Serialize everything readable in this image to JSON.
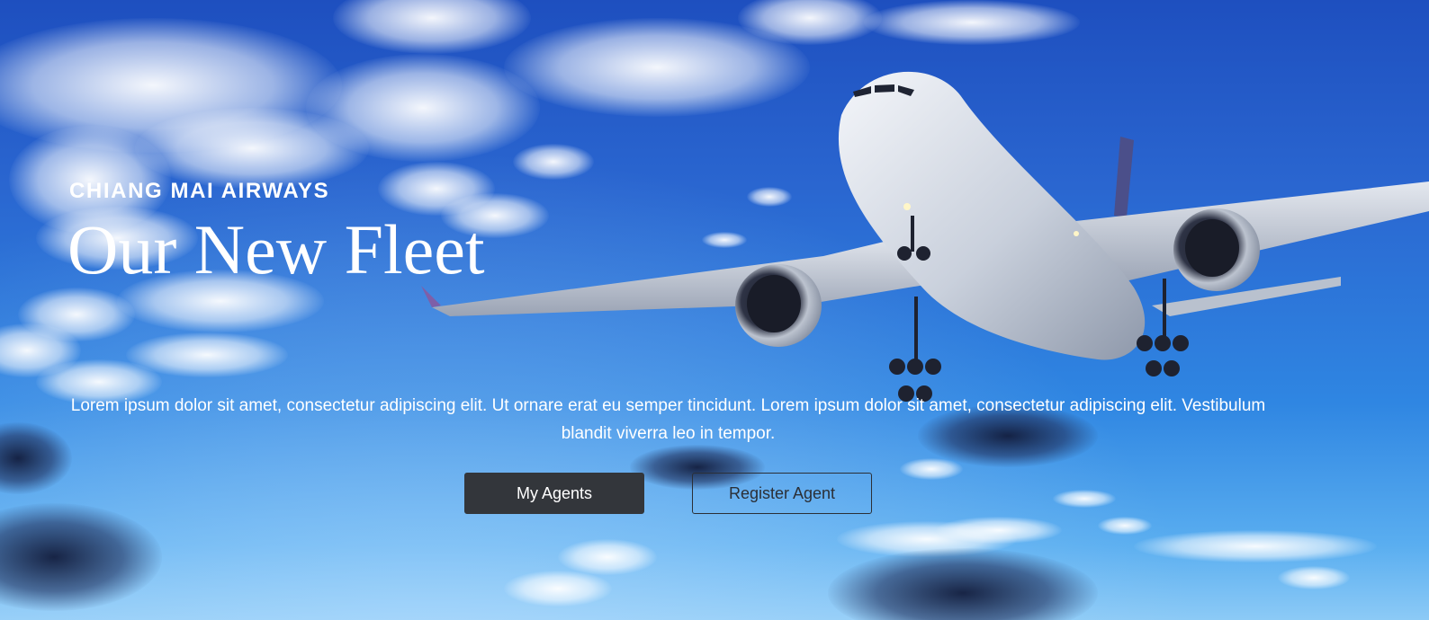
{
  "hero": {
    "brand": "CHIANG MAI AIRWAYS",
    "title": "Our New Fleet",
    "description": "Lorem ipsum dolor sit amet, consectetur adipiscing elit. Ut ornare erat eu semper tincidunt. Lorem ipsum dolor sit amet, consectetur adipiscing elit. Vestibulum blandit viverra leo in tempor."
  },
  "actions": {
    "primary_label": "My Agents",
    "secondary_label": "Register Agent"
  },
  "colors": {
    "sky_top": "#1e4fbf",
    "sky_bottom": "#8ccaf6",
    "primary_button": "#33363b",
    "outline_button": "#2b2f36",
    "text": "#ffffff"
  }
}
